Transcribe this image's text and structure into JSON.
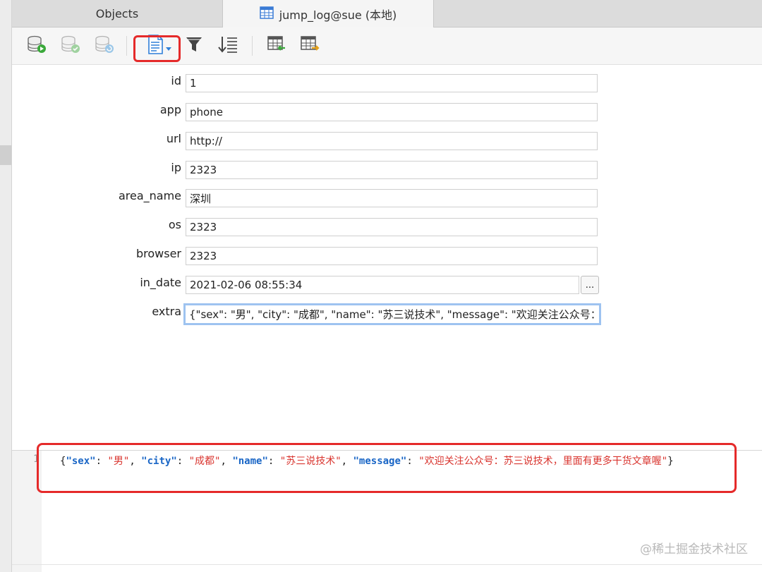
{
  "tabs": [
    {
      "label": "Objects"
    },
    {
      "label": "jump_log@sue (本地)"
    }
  ],
  "toolbar": {
    "buttons": [
      {
        "name": "begin-transaction"
      },
      {
        "name": "commit"
      },
      {
        "name": "rollback"
      },
      {
        "name": "text-view"
      },
      {
        "name": "filter"
      },
      {
        "name": "sort"
      },
      {
        "name": "import"
      },
      {
        "name": "export"
      }
    ]
  },
  "form": {
    "fields": [
      {
        "label": "id",
        "value": "1"
      },
      {
        "label": "app",
        "value": "phone"
      },
      {
        "label": "url",
        "value": "http://"
      },
      {
        "label": "ip",
        "value": "2323"
      },
      {
        "label": "area_name",
        "value": "深圳"
      },
      {
        "label": "os",
        "value": "2323"
      },
      {
        "label": "browser",
        "value": "2323"
      },
      {
        "label": "in_date",
        "value": "2021-02-06 08:55:34"
      },
      {
        "label": "extra",
        "value": "{\"sex\": \"男\", \"city\": \"成都\", \"name\": \"苏三说技术\", \"message\": \"欢迎关注公众号：苏"
      }
    ],
    "date_button_label": "..."
  },
  "editor": {
    "line_number": "1",
    "tokens": [
      {
        "t": "{",
        "c": "p"
      },
      {
        "t": "\"sex\"",
        "c": "k"
      },
      {
        "t": ": ",
        "c": "p"
      },
      {
        "t": "\"男\"",
        "c": "s"
      },
      {
        "t": ", ",
        "c": "p"
      },
      {
        "t": "\"city\"",
        "c": "k"
      },
      {
        "t": ": ",
        "c": "p"
      },
      {
        "t": "\"成都\"",
        "c": "s"
      },
      {
        "t": ", ",
        "c": "p"
      },
      {
        "t": "\"name\"",
        "c": "k"
      },
      {
        "t": ": ",
        "c": "p"
      },
      {
        "t": "\"苏三说技术\"",
        "c": "s"
      },
      {
        "t": ", ",
        "c": "p"
      },
      {
        "t": "\"message\"",
        "c": "k"
      },
      {
        "t": ": ",
        "c": "p"
      },
      {
        "t": "\"欢迎关注公众号：苏三说技术，里面有更多干货文章喔\"",
        "c": "s"
      },
      {
        "t": "}",
        "c": "p"
      }
    ]
  },
  "watermark": "@稀土掘金技术社区",
  "colors": {
    "highlight": "#e52a2a",
    "json_key": "#1a66c6",
    "json_string": "#d9352f",
    "focus_ring": "#9ec3f0"
  }
}
